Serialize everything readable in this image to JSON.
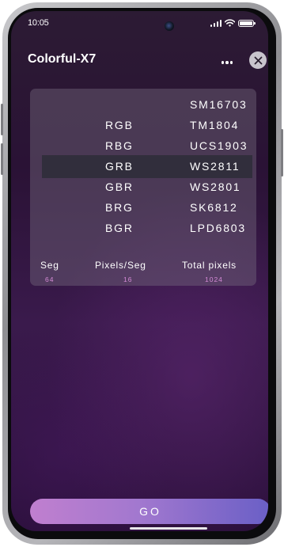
{
  "status_bar": {
    "time": "10:05",
    "icons": [
      "signal-icon",
      "wifi-icon",
      "battery-icon"
    ]
  },
  "header": {
    "title": "Colorful-X7",
    "more_icon": "more-dots-icon",
    "close_icon": "close-icon"
  },
  "picker": {
    "rows": [
      {
        "order": "",
        "chip": "SM16703",
        "selected": false
      },
      {
        "order": "RGB",
        "chip": "TM1804",
        "selected": false
      },
      {
        "order": "RBG",
        "chip": "UCS1903",
        "selected": false
      },
      {
        "order": "GRB",
        "chip": "WS2811",
        "selected": true
      },
      {
        "order": "GBR",
        "chip": "WS2801",
        "selected": false
      },
      {
        "order": "BRG",
        "chip": "SK6812",
        "selected": false
      },
      {
        "order": "BGR",
        "chip": "LPD6803",
        "selected": false
      }
    ]
  },
  "stats": {
    "seg_label": "Seg",
    "seg_value": "64",
    "pixels_label": "Pixels/Seg",
    "pixels_value": "16",
    "total_label": "Total pixels",
    "total_value": "1024"
  },
  "go_button": {
    "label": "GO"
  },
  "colors": {
    "background_top": "#2c1b34",
    "background_mid": "#3a1a4c",
    "value_pink": "#d48ad6",
    "go_gradient_start": "#c07fcf",
    "go_gradient_end": "#6a5fc6"
  }
}
